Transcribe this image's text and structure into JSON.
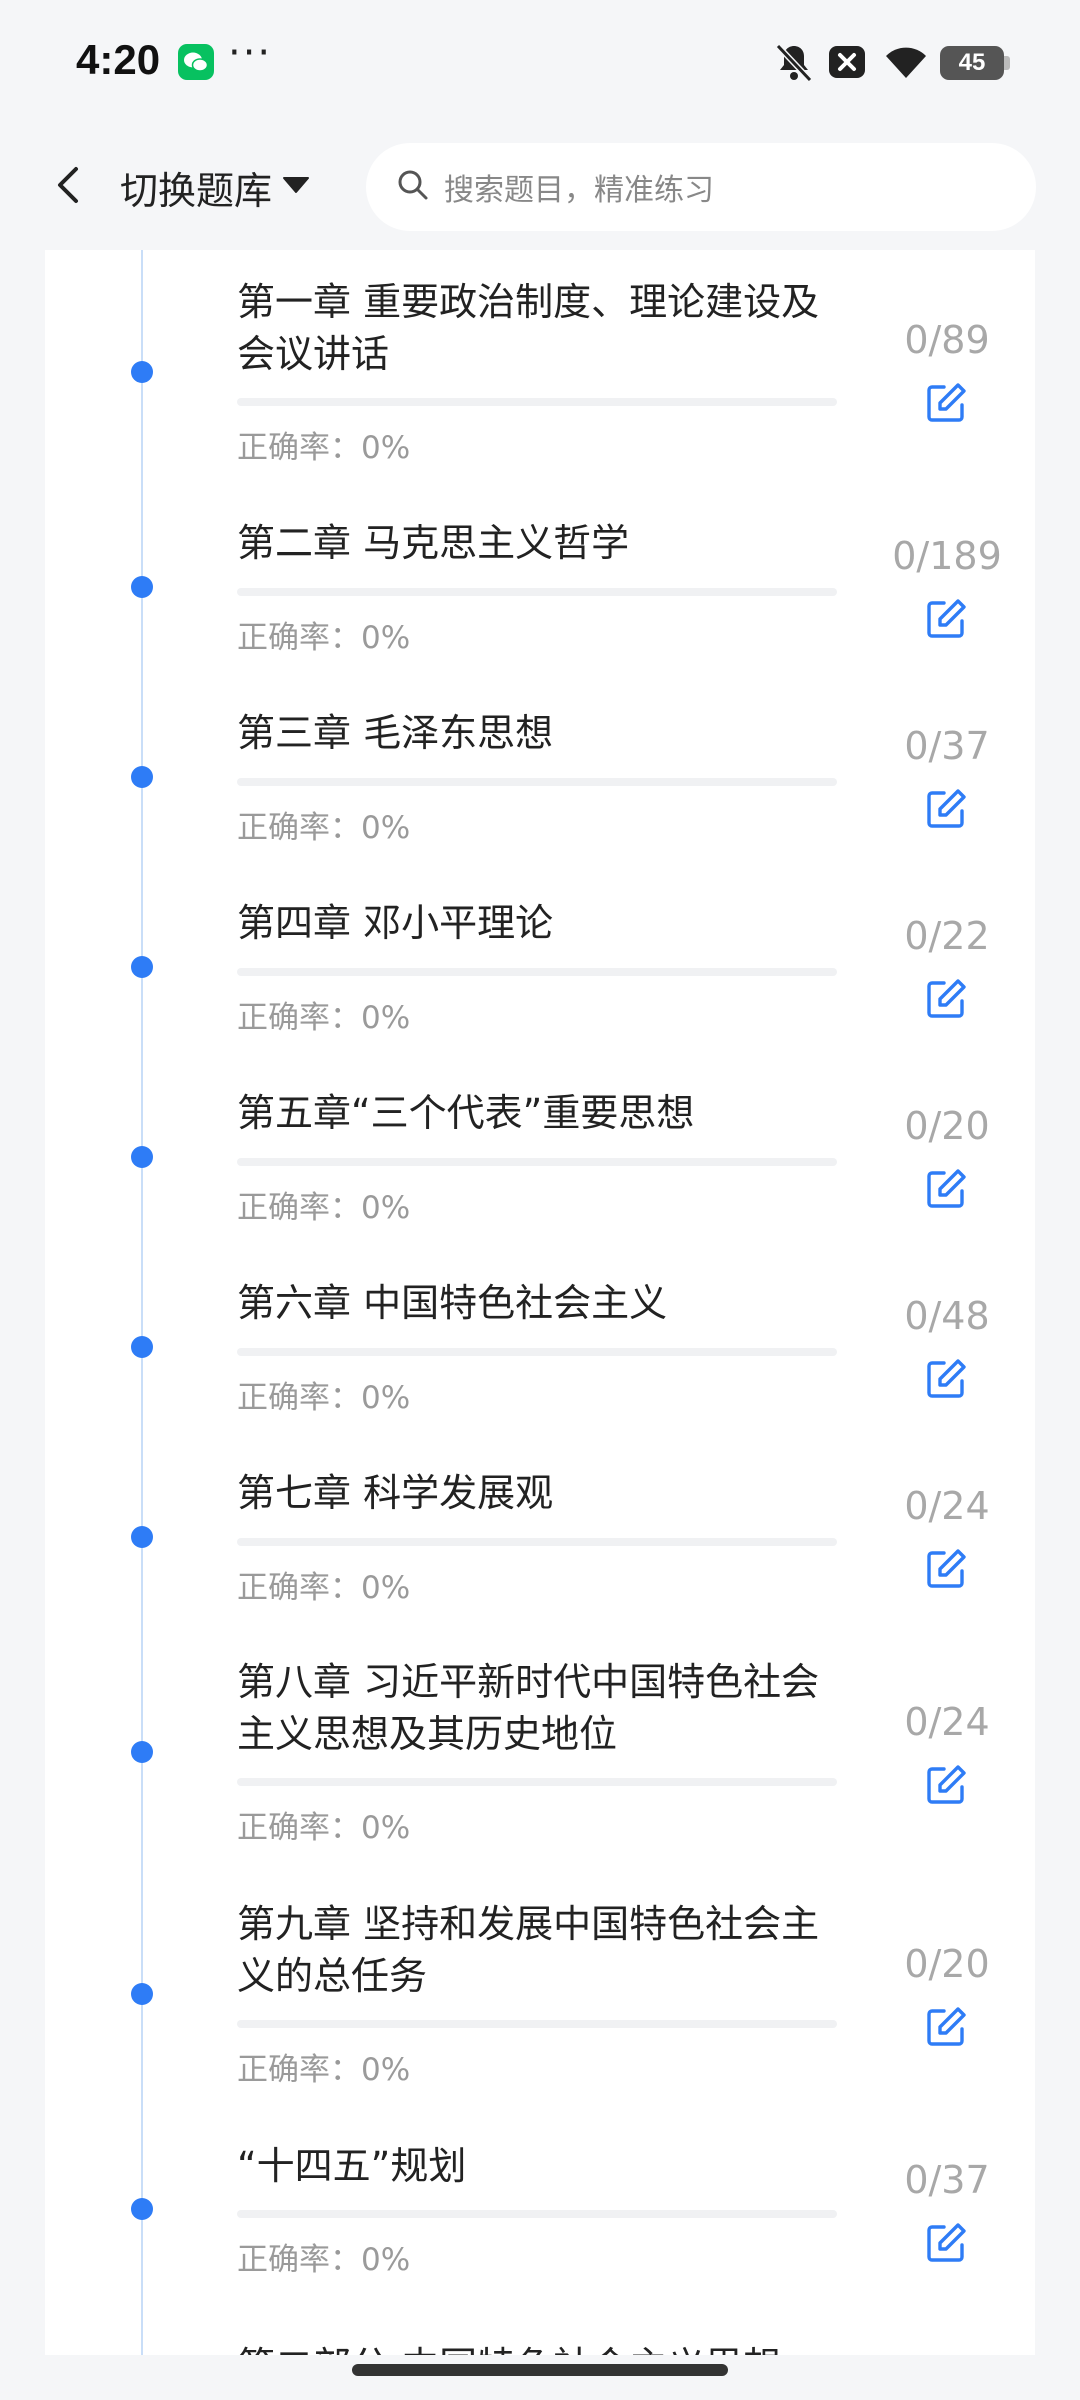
{
  "status_bar": {
    "time": "4:20",
    "app_icon": "wechat-icon",
    "more": "···",
    "icons": [
      "bell-off-icon",
      "close-box-icon",
      "wifi-icon"
    ],
    "battery": "45"
  },
  "header": {
    "back_icon": "chevron-left-icon",
    "switch_label": "切换题库",
    "switch_icon": "caret-down-icon",
    "search_icon": "search-icon",
    "search_placeholder": "搜索题目，精准练习"
  },
  "accent_color": "#2e7cf6",
  "chapters": [
    {
      "title": "第一章 重要政治制度、理论建设及会议讲话",
      "accuracy": "正确率：0%",
      "count": "0/89",
      "progress": 0
    },
    {
      "title": "第二章 马克思主义哲学",
      "accuracy": "正确率：0%",
      "count": "0/189",
      "progress": 0
    },
    {
      "title": "第三章 毛泽东思想",
      "accuracy": "正确率：0%",
      "count": "0/37",
      "progress": 0
    },
    {
      "title": "第四章 邓小平理论",
      "accuracy": "正确率：0%",
      "count": "0/22",
      "progress": 0
    },
    {
      "title": "第五章“三个代表”重要思想",
      "accuracy": "正确率：0%",
      "count": "0/20",
      "progress": 0
    },
    {
      "title": "第六章 中国特色社会主义",
      "accuracy": "正确率：0%",
      "count": "0/48",
      "progress": 0
    },
    {
      "title": "第七章 科学发展观",
      "accuracy": "正确率：0%",
      "count": "0/24",
      "progress": 0
    },
    {
      "title": "第八章 习近平新时代中国特色社会主义思想及其历史地位",
      "accuracy": "正确率：0%",
      "count": "0/24",
      "progress": 0
    },
    {
      "title": "第九章 坚持和发展中国特色社会主义的总任务",
      "accuracy": "正确率：0%",
      "count": "0/20",
      "progress": 0
    },
    {
      "title": "“十四五”规划",
      "accuracy": "正确率：0%",
      "count": "0/37",
      "progress": 0
    }
  ],
  "partial_next_title": "第二部分 中国特色社会主义思想"
}
